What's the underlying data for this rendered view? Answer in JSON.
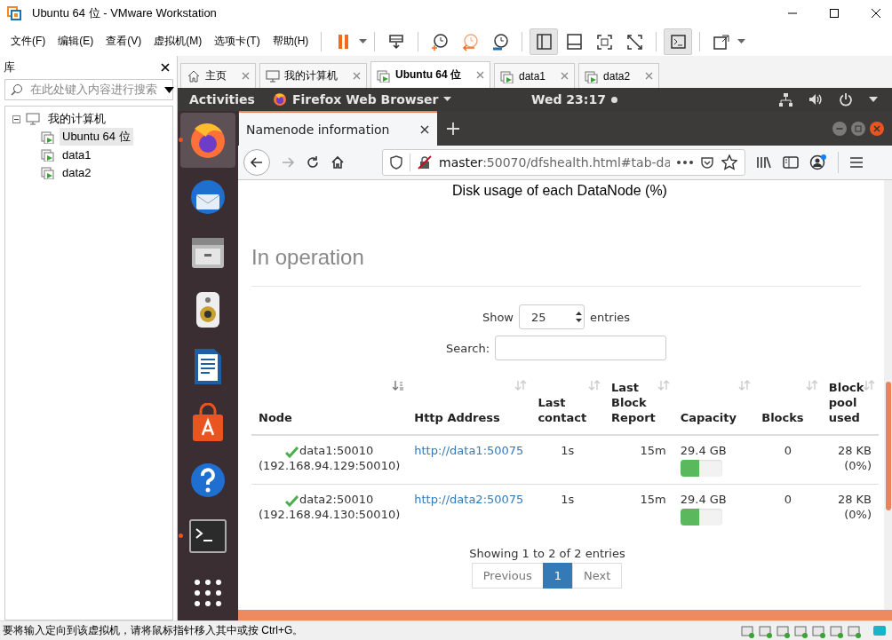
{
  "window": {
    "title": "Ubuntu 64 位 - VMware Workstation"
  },
  "menu": [
    "文件(F)",
    "编辑(E)",
    "查看(V)",
    "虚拟机(M)",
    "选项卡(T)",
    "帮助(H)"
  ],
  "toolbar": [
    {
      "kind": "pause",
      "pressed": false
    },
    {
      "kind": "send-keys",
      "pressed": false
    },
    {
      "kind": "snapshot",
      "pressed": false
    },
    {
      "kind": "revert",
      "pressed": false
    },
    {
      "kind": "manage-snapshots",
      "pressed": false
    },
    {
      "kind": "library",
      "pressed": true
    },
    {
      "kind": "thumbnails",
      "pressed": false
    },
    {
      "kind": "fullscreen",
      "pressed": false
    },
    {
      "kind": "unity",
      "pressed": false
    },
    {
      "kind": "console",
      "pressed": true
    },
    {
      "kind": "stretch",
      "pressed": false
    }
  ],
  "library": {
    "title": "库",
    "search": {
      "placeholder": "在此处键入内容进行搜索"
    },
    "tree": [
      {
        "label": "我的计算机",
        "expanded": true,
        "selected": false,
        "children": [
          {
            "label": "Ubuntu 64 位",
            "selected": true
          },
          {
            "label": "data1",
            "selected": false
          },
          {
            "label": "data2",
            "selected": false
          }
        ]
      }
    ]
  },
  "tabs": [
    {
      "label": "主页",
      "kind": "home",
      "selected": false
    },
    {
      "label": "我的计算机",
      "kind": "computer",
      "selected": false
    },
    {
      "label": "Ubuntu 64 位",
      "kind": "vm",
      "selected": true
    },
    {
      "label": "data1",
      "kind": "vm",
      "selected": false
    },
    {
      "label": "data2",
      "kind": "vm",
      "selected": false
    }
  ],
  "ubuntu": {
    "activities": "Activities",
    "app_menu": "Firefox Web Browser",
    "clock": "Wed 23:17"
  },
  "dock": [
    {
      "kind": "firefox",
      "running": true,
      "selected": true
    },
    {
      "kind": "thunderbird",
      "running": false,
      "selected": false
    },
    {
      "kind": "files",
      "running": false,
      "selected": false
    },
    {
      "kind": "rhythmbox",
      "running": false,
      "selected": false
    },
    {
      "kind": "writer",
      "running": false,
      "selected": false
    },
    {
      "kind": "software",
      "running": false,
      "selected": false
    },
    {
      "kind": "help",
      "running": false,
      "selected": false
    },
    {
      "kind": "terminal",
      "running": true,
      "selected": false
    },
    {
      "kind": "apps",
      "running": false,
      "selected": false
    }
  ],
  "browser": {
    "tab": "Namenode information",
    "url_host": "master",
    "url_path": ":50070/dfshealth.html#tab-da"
  },
  "page": {
    "chart_caption": "Disk usage of each DataNode (%)",
    "heading": "In operation",
    "show_label": "Show",
    "page_size": "25",
    "entries_label": "entries",
    "search_label": "Search:",
    "columns": [
      {
        "label": "Node",
        "sorted": true
      },
      {
        "label": "Http Address",
        "sorted": false
      },
      {
        "label": "Last contact",
        "sorted": false
      },
      {
        "label": "Last Block Report",
        "sorted": false
      },
      {
        "label": "Capacity",
        "sorted": false
      },
      {
        "label": "Blocks",
        "sorted": false
      },
      {
        "label": "Block pool used",
        "sorted": false
      }
    ],
    "rows": [
      {
        "node": "data1:50010",
        "address": "(192.168.94.129:50010)",
        "alive": true,
        "http": "http://data1:50075",
        "last_contact": "1s",
        "last_block_report": "15m",
        "capacity": "29.4 GB",
        "level": 0.45,
        "blocks": "0",
        "pool_used": "28 KB",
        "pool_percent": "(0%)"
      },
      {
        "node": "data2:50010",
        "address": "(192.168.94.130:50010)",
        "alive": true,
        "http": "http://data2:50075",
        "last_contact": "1s",
        "last_block_report": "15m",
        "capacity": "29.4 GB",
        "level": 0.45,
        "blocks": "0",
        "pool_used": "28 KB",
        "pool_percent": "(0%)"
      }
    ],
    "info": "Showing 1 to 2 of 2 entries",
    "pagination": [
      {
        "label": "Previous",
        "selected": false,
        "disabled": true
      },
      {
        "label": "1",
        "selected": true,
        "disabled": false
      },
      {
        "label": "Next",
        "selected": false,
        "disabled": true
      }
    ]
  },
  "status_bar": {
    "message": "要将输入定向到该虚拟机，请将鼠标指针移入其中或按 Ctrl+G。"
  }
}
